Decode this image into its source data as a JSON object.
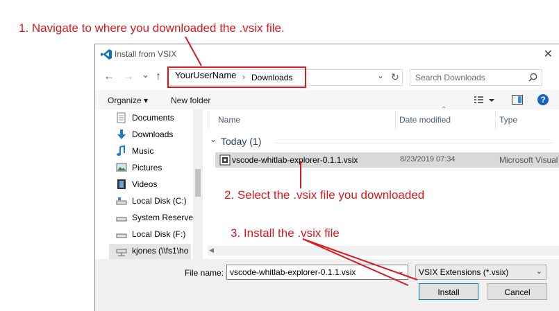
{
  "annotations": {
    "step1": "1. Navigate to where you downloaded the .vsix file.",
    "step2": "2. Select the .vsix file you downloaded",
    "step3": "3. Install the .vsix file"
  },
  "dialog": {
    "title": "Install from VSIX",
    "close_glyph": "✕",
    "nav": {
      "back": "←",
      "forward": "→",
      "recent": "⌄",
      "up": "↑",
      "refresh": "↻"
    },
    "address": {
      "segment1": "YourUserName",
      "separator": "›",
      "segment2": "Downloads",
      "dropdown": "⌄"
    },
    "search": {
      "placeholder": "Search Downloads"
    },
    "toolbar": {
      "organize": "Organize ▾",
      "new_folder": "New folder"
    },
    "tree": [
      {
        "label": "Documents",
        "icon": "documents-icon"
      },
      {
        "label": "Downloads",
        "icon": "downloads-icon"
      },
      {
        "label": "Music",
        "icon": "music-icon"
      },
      {
        "label": "Pictures",
        "icon": "pictures-icon"
      },
      {
        "label": "Videos",
        "icon": "videos-icon"
      },
      {
        "label": "Local Disk (C:)",
        "icon": "drive-icon"
      },
      {
        "label": "System Reserved",
        "icon": "drive-icon"
      },
      {
        "label": "Local Disk (F:)",
        "icon": "drive-icon"
      },
      {
        "label": "kjones (\\\\fs1\\ho",
        "icon": "network-drive-icon"
      }
    ],
    "columns": {
      "name": "Name",
      "date": "Date modified",
      "type": "Type"
    },
    "group": {
      "label": "Today (1)",
      "chevron": "⌄"
    },
    "file": {
      "name": "vscode-whitlab-explorer-0.1.1.vsix",
      "date": "8/23/2019 07:34",
      "type": "Microsoft Visual"
    },
    "filename_label": "File name:",
    "filename_value": "vscode-whitlab-explorer-0.1.1.vsix",
    "filter_value": "VSIX Extensions (*.vsix)",
    "install_label": "Install",
    "cancel_label": "Cancel",
    "help_glyph": "?"
  },
  "colors": {
    "annotation": "#d9181e",
    "vscode_blue": "#0e70c0",
    "help_blue": "#1565c0"
  }
}
